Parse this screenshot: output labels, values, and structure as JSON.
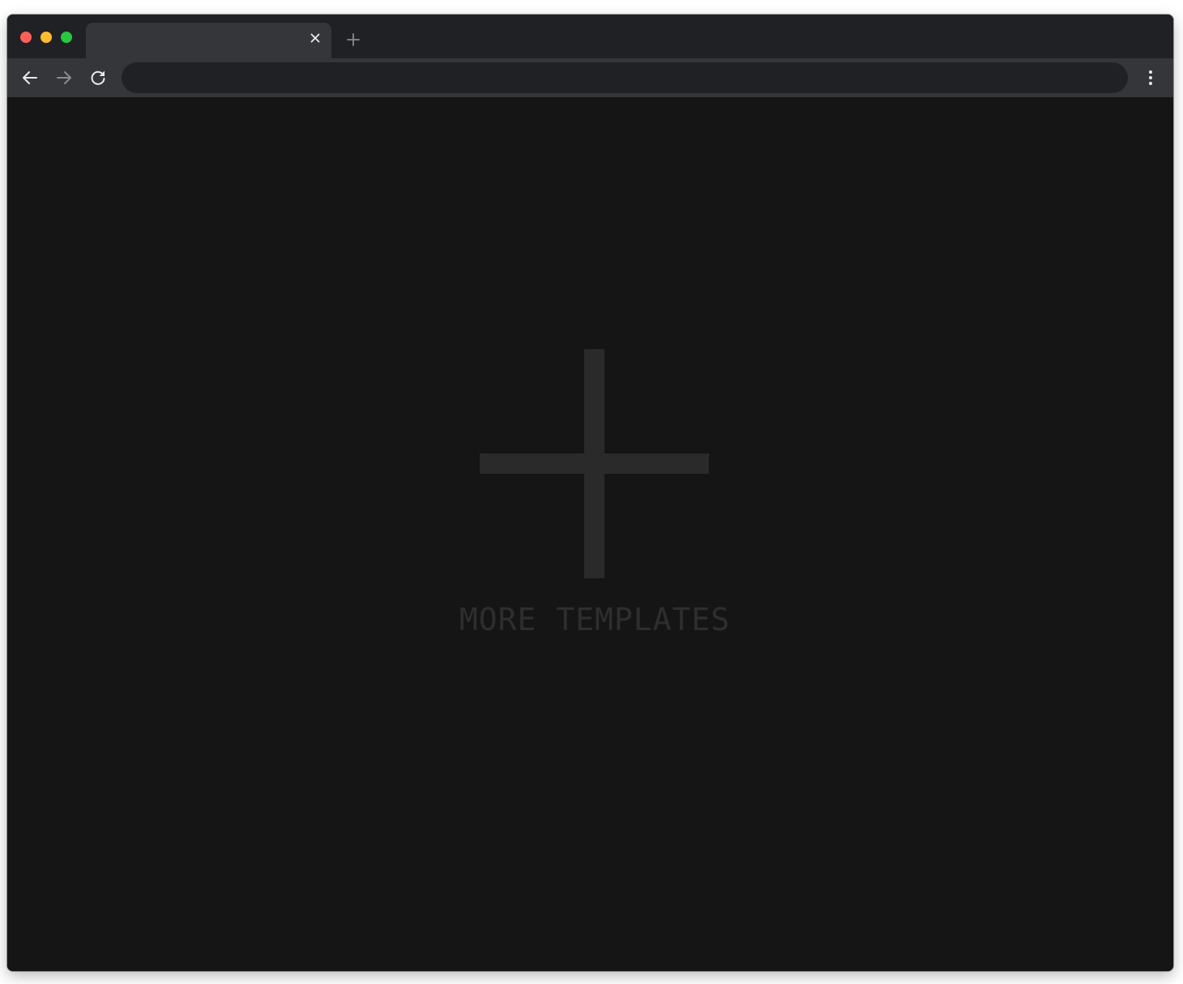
{
  "colors": {
    "titlebar": "#202124",
    "tab_active": "#35363a",
    "toolbar": "#35363a",
    "omnibox": "#202124",
    "content_bg": "#151515",
    "traffic_close": "#ff5f57",
    "traffic_minimize": "#febc2e",
    "traffic_maximize": "#28c840",
    "icon_active": "#e8eaed",
    "icon_disabled": "#8a8b8e",
    "placeholder_plus": "#2a2a2a",
    "placeholder_text": "#2e2e2e"
  },
  "browser": {
    "tabs": [
      {
        "title": "",
        "active": true
      }
    ],
    "address_bar": {
      "value": "",
      "placeholder": ""
    },
    "nav": {
      "back_icon": "arrow-left-icon",
      "forward_icon": "arrow-right-icon",
      "reload_icon": "reload-icon",
      "menu_icon": "vertical-dots-icon",
      "forward_enabled": false
    }
  },
  "page": {
    "add_tile": {
      "icon": "plus-icon",
      "label": "MORE TEMPLATES"
    }
  }
}
